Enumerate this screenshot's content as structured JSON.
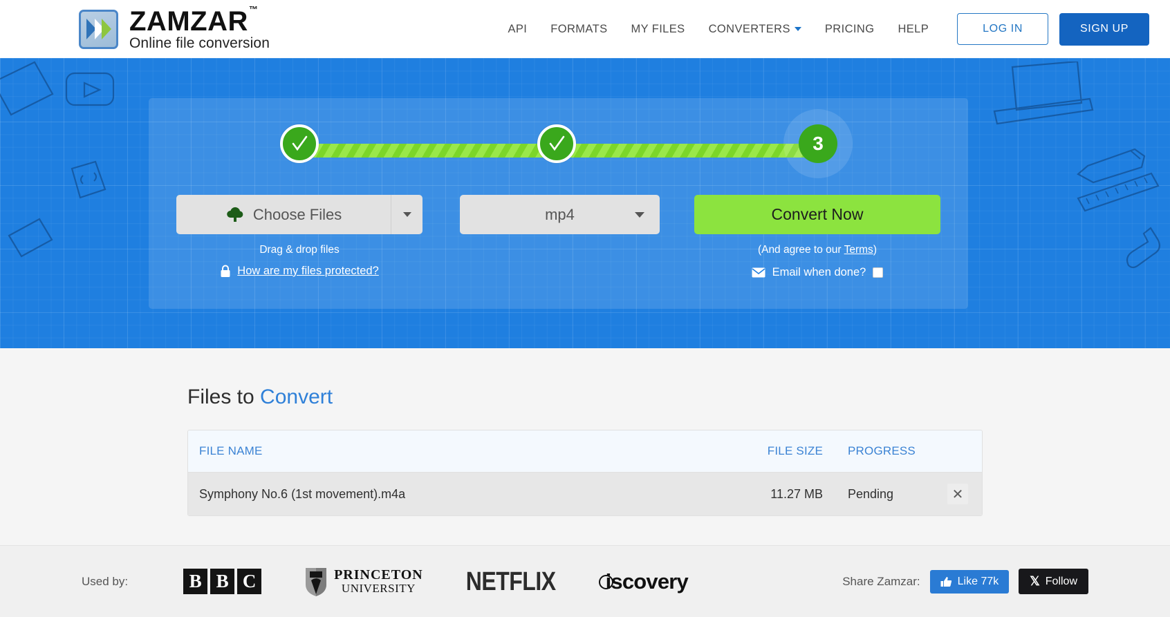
{
  "brand": {
    "name": "ZAMZAR",
    "tm": "™",
    "tagline": "Online file conversion"
  },
  "nav": {
    "items": [
      {
        "label": "API",
        "caret": false
      },
      {
        "label": "FORMATS",
        "caret": false
      },
      {
        "label": "MY FILES",
        "caret": false
      },
      {
        "label": "CONVERTERS",
        "caret": true
      },
      {
        "label": "PRICING",
        "caret": false
      },
      {
        "label": "HELP",
        "caret": false
      }
    ],
    "login_label": "LOG IN",
    "signup_label": "SIGN UP",
    "accent_blue": "#1464c0"
  },
  "hero": {
    "background_color": "#1f7fe0",
    "steps": [
      {
        "id": 1,
        "state": "done",
        "glyph": "check"
      },
      {
        "id": 2,
        "state": "done",
        "glyph": "check"
      },
      {
        "id": 3,
        "state": "current",
        "glyph": "3"
      }
    ],
    "step_color_done": "#3aa81c",
    "bar_color": "#7cd629",
    "choose_files": {
      "label": "Choose Files",
      "icon": "cloud-upload-icon",
      "hint": "Drag & drop files",
      "protected_link": "How are my files protected?",
      "lock_icon": "lock-icon"
    },
    "format": {
      "value": "mp4"
    },
    "convert": {
      "label": "Convert Now",
      "button_color": "#8ce33f",
      "terms_prefix": "(And agree to our ",
      "terms_link": "Terms",
      "terms_suffix": ")",
      "email_label": "Email when done?",
      "email_icon": "envelope-icon",
      "email_checked": false
    }
  },
  "files_section": {
    "title_plain": "Files to ",
    "title_accent": "Convert",
    "columns": [
      "FILE NAME",
      "FILE SIZE",
      "PROGRESS"
    ],
    "rows": [
      {
        "name": "Symphony No.6 (1st movement).m4a",
        "size": "11.27 MB",
        "progress": "Pending",
        "remove": "✕"
      }
    ]
  },
  "footer": {
    "used_by_label": "Used by:",
    "brands": [
      "BBC",
      "PRINCETON UNIVERSITY",
      "NETFLIX",
      "Discovery"
    ],
    "princeton_line1": "PRINCETON",
    "princeton_line2": "UNIVERSITY",
    "netflix": "NETFLIX",
    "discovery": "iscovery",
    "share_label": "Share Zamzar:",
    "facebook_label": "Like 77k",
    "twitter_label": "Follow"
  }
}
